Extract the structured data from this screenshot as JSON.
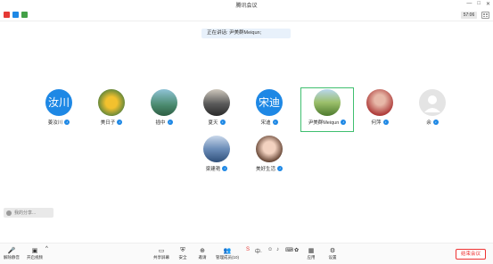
{
  "window": {
    "title": "腾讯会议"
  },
  "topbar": {
    "time": "57:06"
  },
  "speaking": {
    "label": "正在讲话: 尹美群Meiqun;"
  },
  "participants": [
    {
      "name": "姜汝川",
      "avatar_text": "汝川",
      "avatar_color": "#1e88e5",
      "mic": "blue"
    },
    {
      "name": "美日子",
      "avatar_text": "",
      "avatar_color": "#d4a017",
      "mic": "blue"
    },
    {
      "name": "插中",
      "avatar_text": "",
      "avatar_color": "#4a8a6e",
      "mic": "blue"
    },
    {
      "name": "夏天",
      "avatar_text": "",
      "avatar_color": "#5a5a5a",
      "mic": "blue"
    },
    {
      "name": "宋迪",
      "avatar_text": "宋迪",
      "avatar_color": "#1e88e5",
      "mic": "blue"
    },
    {
      "name": "尹美群Meiqun",
      "avatar_text": "",
      "avatar_color": "#6a9a4a",
      "mic": "blue"
    },
    {
      "name": "何萍",
      "avatar_text": "",
      "avatar_color": "#b0403e",
      "mic": "blue"
    },
    {
      "name": "余",
      "avatar_text": "",
      "avatar_color": "#d6d6d6",
      "mic": "blue"
    },
    {
      "name": "梁建艳",
      "avatar_text": "",
      "avatar_color": "#6b8db8",
      "mic": "blue"
    },
    {
      "name": "美好生活",
      "avatar_text": "",
      "avatar_color": "#e8c4b0",
      "mic": "blue"
    }
  ],
  "sharing": {
    "label": "我的分享..."
  },
  "bottombar": {
    "mute": "解除静音",
    "video": "开启视频",
    "share": "共享屏幕",
    "security": "安全",
    "invite": "邀请",
    "members": "管理成员(10)",
    "apps": "应用",
    "settings": "设置",
    "end": "结束会议"
  }
}
